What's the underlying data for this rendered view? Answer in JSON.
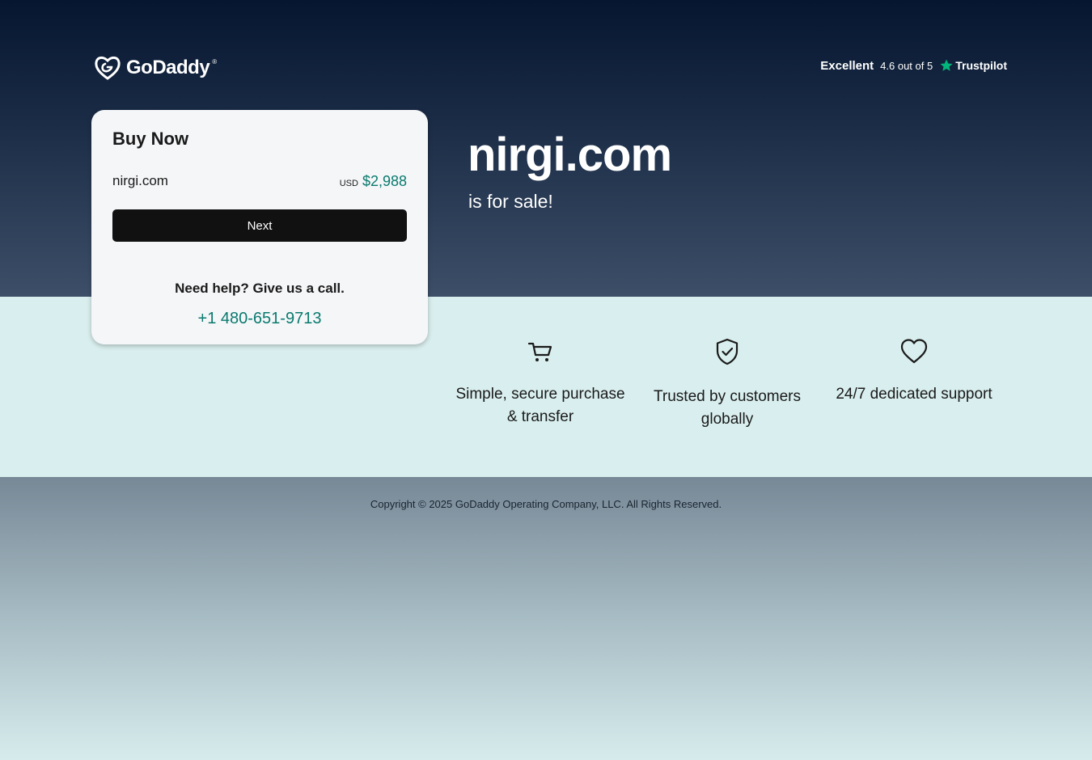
{
  "header": {
    "logo_text": "GoDaddy",
    "logo_tm": "®",
    "rating": {
      "label": "Excellent",
      "score_text": "4.6 out of 5",
      "brand": "Trustpilot"
    }
  },
  "card": {
    "title": "Buy Now",
    "domain": "nirgi.com",
    "currency": "USD",
    "price": "$2,988",
    "next_label": "Next",
    "help_text": "Need help? Give us a call.",
    "phone": "+1 480-651-9713"
  },
  "hero": {
    "domain": "nirgi.com",
    "subtitle": "is for sale!"
  },
  "features": [
    {
      "icon": "cart-icon",
      "label": "Simple, secure purchase & transfer"
    },
    {
      "icon": "shield-check-icon",
      "label": "Trusted by customers globally"
    },
    {
      "icon": "heart-icon",
      "label": "24/7 dedicated support"
    }
  ],
  "footer": {
    "copyright": "Copyright © 2025 GoDaddy Operating Company, LLC. All Rights Reserved."
  },
  "colors": {
    "accent_teal": "#0b7a6e",
    "trustpilot_green": "#00b67a",
    "button_bg": "#111111",
    "features_bg": "#d9eeee"
  }
}
